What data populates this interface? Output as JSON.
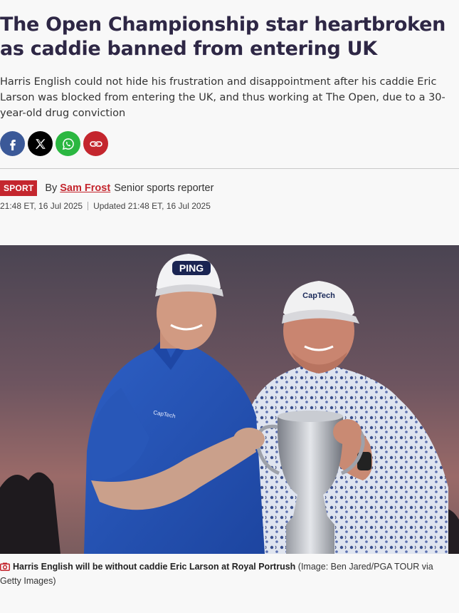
{
  "article": {
    "headline": "The Open Championship star heartbroken as caddie banned from entering UK",
    "standfirst": "Harris English could not hide his frustration and disappointment after his caddie Eric Larson was blocked from entering the UK, and thus working at The Open, due to a 30-year-old drug conviction"
  },
  "share": {
    "icons": [
      "facebook-icon",
      "x-icon",
      "whatsapp-icon",
      "link-icon"
    ]
  },
  "byline": {
    "section": "SPORT",
    "by": "By",
    "author": "Sam Frost",
    "role": "Senior sports reporter",
    "published": "21:48 ET, 16 Jul 2025",
    "updated": "Updated 21:48 ET, 16 Jul 2025"
  },
  "photo": {
    "cap_left": "PING",
    "cap_right": "CapTech",
    "shirt_logo": "CapTech"
  },
  "caption": {
    "icon": "camera-icon",
    "text": "Harris English will be without caddie Eric Larson at Royal Portrush",
    "credit": "(Image: Ben Jared/PGA TOUR via Getty Images)"
  },
  "colors": {
    "headline": "#2e2745",
    "accent": "#c4262e",
    "facebook": "#3b5998",
    "whatsapp": "#2bb741"
  }
}
